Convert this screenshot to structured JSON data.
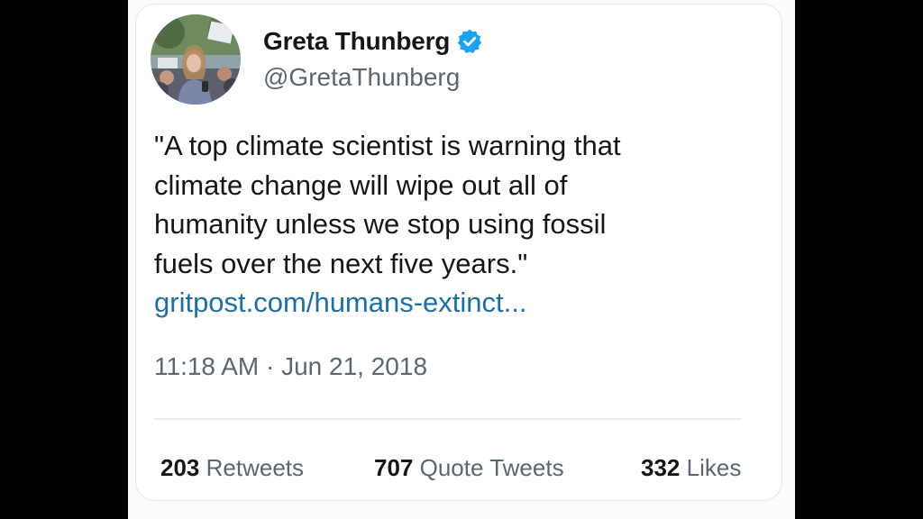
{
  "author": {
    "display_name": "Greta Thunberg",
    "handle": "@GretaThunberg",
    "verified_icon": "verified-badge-icon",
    "avatar": "profile-photo"
  },
  "tweet": {
    "text_lines": [
      "\"A top climate scientist is warning that",
      "climate change will wipe out all of",
      "humanity unless we stop using fossil",
      "fuels over the next five years.\""
    ],
    "link": "gritpost.com/humans-extinct...",
    "timestamp": "11:18 AM · Jun 21, 2018"
  },
  "stats": {
    "retweets": {
      "count": "203",
      "label": "Retweets"
    },
    "quote_tweets": {
      "count": "707",
      "label": "Quote Tweets"
    },
    "likes": {
      "count": "332",
      "label": "Likes"
    }
  },
  "colors": {
    "text": "#14171a",
    "muted": "#5b6770",
    "link": "#1d6fa3",
    "verified": "#1da1f2"
  }
}
